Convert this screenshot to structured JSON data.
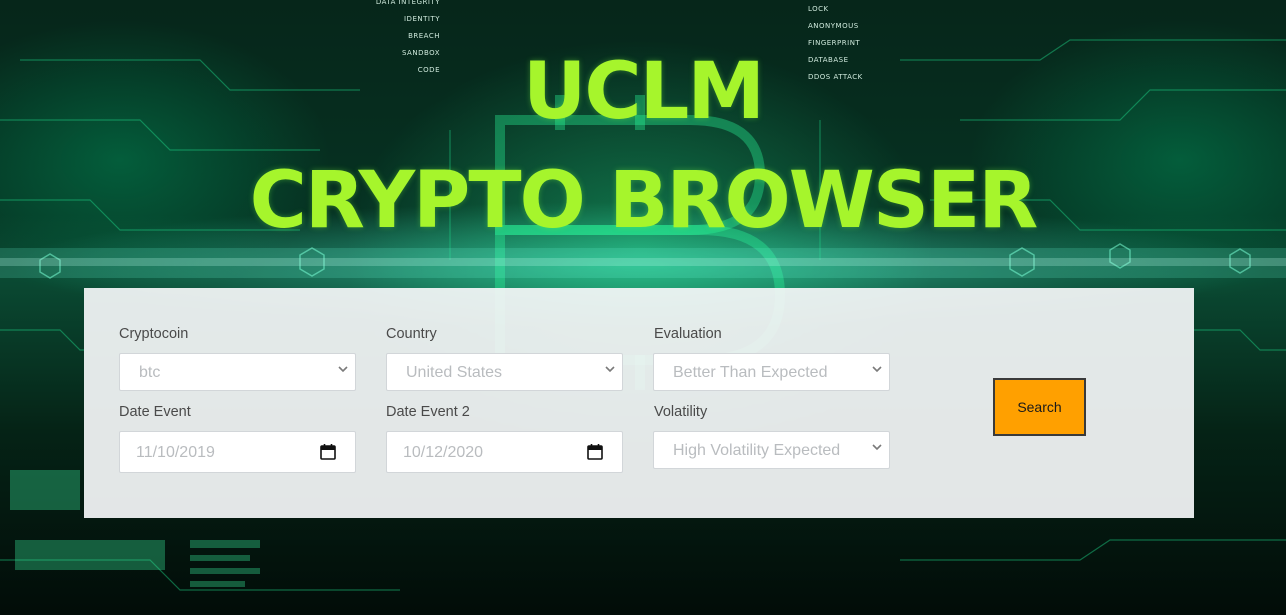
{
  "header": {
    "title_line1": "UCLM",
    "title_line2": "CRYPTO BROWSER"
  },
  "background": {
    "hud_left": [
      "DATA INTEGRITY",
      "IDENTITY",
      "BREACH",
      "SANDBOX",
      "CODE"
    ],
    "hud_right": [
      "LOCK",
      "ANONYMOUS",
      "FINGERPRINT",
      "DATABASE",
      "DDOS ATTACK"
    ]
  },
  "form": {
    "cryptocoin": {
      "label": "Cryptocoin",
      "value": "btc"
    },
    "country": {
      "label": "Country",
      "value": "United States"
    },
    "evaluation": {
      "label": "Evaluation",
      "value": "Better Than Expected"
    },
    "date_event": {
      "label": "Date Event",
      "value": "11/10/2019"
    },
    "date_event_2": {
      "label": "Date Event 2",
      "value": "10/12/2020"
    },
    "volatility": {
      "label": "Volatility",
      "value": "High Volatility Expected"
    },
    "search_label": "Search"
  },
  "colors": {
    "title": "#a6f52c",
    "button": "#ffa000",
    "panel": "#f4f6f7"
  }
}
